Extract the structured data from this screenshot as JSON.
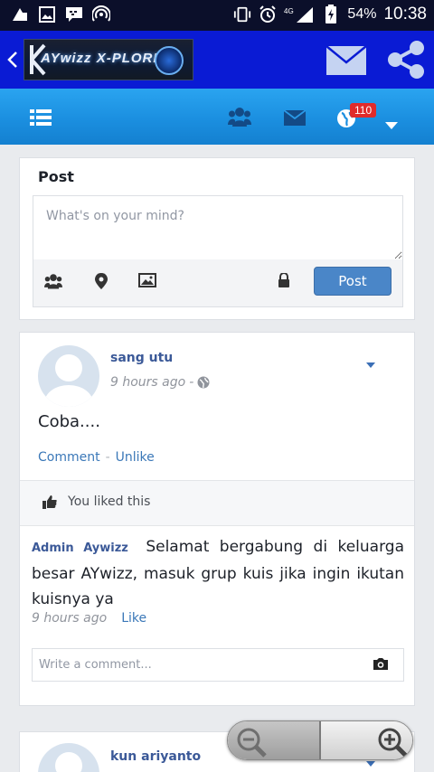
{
  "status_bar": {
    "battery": "54%",
    "time": "10:38",
    "network": "4G"
  },
  "app_bar": {
    "logo_text": "AYwizz X-PLORE"
  },
  "toolbar": {
    "notification_count": "110"
  },
  "post_box": {
    "title": "Post",
    "placeholder": "What's on your mind?",
    "post_button": "Post"
  },
  "feed": [
    {
      "author": "sang utu",
      "time": "9 hours ago",
      "separator": "-",
      "text": "Coba....",
      "comment_label": "Comment",
      "action_sep": "-",
      "unlike_label": "Unlike",
      "likes_text": "You liked this",
      "comments": [
        {
          "author": "Admin Aywizz",
          "text": "Selamat bergabung di keluarga besar AYwizz, masuk grup kuis jika ingin ikutan kuisnya ya",
          "time": "9 hours ago",
          "like_label": "Like"
        }
      ],
      "comment_placeholder": "Write a comment..."
    },
    {
      "author": "kun ariyanto"
    }
  ],
  "colors": {
    "status_bar": "#0b0f2a",
    "app_bar": "#0a1bd4",
    "toolbar": "#1b8fe0",
    "link": "#3b5998",
    "badge": "#e02b2b",
    "post_button": "#4a86c8"
  }
}
